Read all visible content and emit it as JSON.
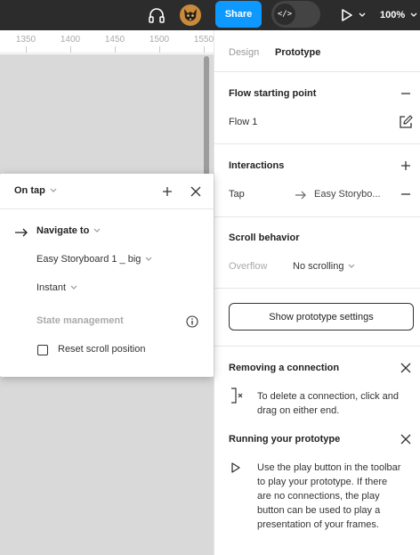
{
  "toolbar": {
    "share_label": "Share",
    "dev_mode_symbol": "</>",
    "zoom": "100%",
    "icons": [
      "headphones-icon",
      "avatar",
      "play-icon",
      "chevron-down-icon"
    ]
  },
  "ruler": {
    "ticks": [
      "1350",
      "1400",
      "1450",
      "1500",
      "1550"
    ]
  },
  "panel": {
    "tabs": {
      "design": "Design",
      "prototype": "Prototype"
    },
    "flow": {
      "title": "Flow starting point",
      "flow_name": "Flow 1"
    },
    "interactions": {
      "title": "Interactions",
      "trigger": "Tap",
      "target": "Easy Storybo..."
    },
    "scroll": {
      "title": "Scroll behavior",
      "overflow_label": "Overflow",
      "overflow_value": "No scrolling"
    },
    "settings_button": "Show prototype settings",
    "removing": {
      "title": "Removing a connection",
      "text_line1": "To delete a connection, click and",
      "text_line2": "drag on either end."
    },
    "running": {
      "title": "Running your prototype",
      "text_lines": [
        "Use the play button in the toolbar",
        "to play your prototype. If there",
        "are no connections, the play",
        "button can be used to play a",
        "presentation of your frames."
      ]
    }
  },
  "popup": {
    "trigger": "On tap",
    "action": "Navigate to",
    "destination": "Easy Storyboard 1 _ big",
    "animation": "Instant",
    "state_label": "State management",
    "reset_label": "Reset scroll position",
    "reset_checked": false
  },
  "colors": {
    "accent": "#0d99ff",
    "toolbar": "#2c2c2c",
    "canvas": "#d9d9d9"
  }
}
